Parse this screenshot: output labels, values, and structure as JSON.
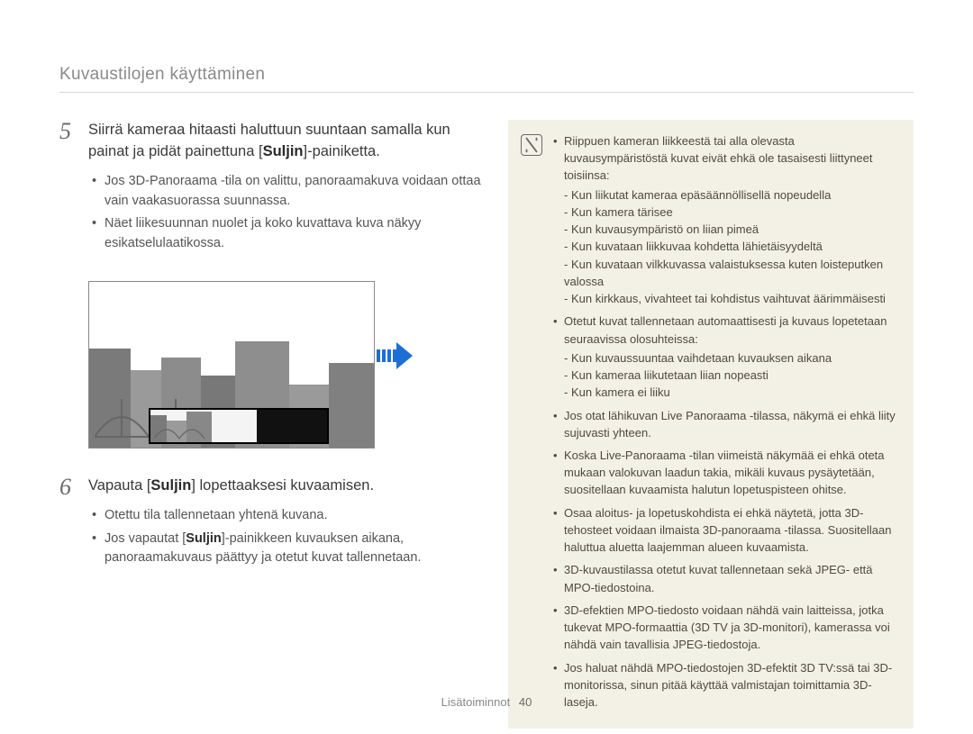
{
  "header": {
    "title": "Kuvaustilojen käyttäminen"
  },
  "steps": {
    "s5": {
      "num": "5",
      "title_before": "Siirrä kameraa hitaasti haluttuun suuntaan samalla kun painat ja pidät painettuna [",
      "title_bold": "Suljin",
      "title_after": "]-painiketta.",
      "bullets": [
        "Jos 3D-Panoraama -tila on valittu, panoraamakuva voidaan ottaa vain vaakasuorassa suunnassa.",
        "Näet liikesuunnan nuolet ja koko kuvattava kuva näkyy esikatselulaatikossa."
      ]
    },
    "s6": {
      "num": "6",
      "title_before": "Vapauta [",
      "title_bold": "Suljin",
      "title_after": "] lopettaaksesi kuvaamisen.",
      "bullets_plain": "Otettu tila tallennetaan yhtenä kuvana.",
      "bullet2_before": "Jos vapautat [",
      "bullet2_bold": "Suljin",
      "bullet2_after": "]-painikkeen kuvauksen aikana, panoraamakuvaus päättyy ja otetut kuvat tallennetaan."
    }
  },
  "info": {
    "b1": {
      "text": "Riippuen kameran liikkeestä tai alla olevasta kuvausympäristöstä kuvat eivät ehkä ole tasaisesti liittyneet toisiinsa:",
      "subs": [
        "Kun liikutat kameraa epäsäännöllisellä nopeudella",
        "Kun kamera tärisee",
        "Kun kuvausympäristö on liian pimeä",
        "Kun kuvataan liikkuvaa kohdetta lähietäisyydeltä",
        "Kun kuvataan vilkkuvassa valaistuksessa kuten loisteputken valossa",
        "Kun kirkkaus, vivahteet tai kohdistus vaihtuvat äärimmäisesti"
      ]
    },
    "b2": {
      "text": "Otetut kuvat tallennetaan automaattisesti ja kuvaus lopetetaan seuraavissa olosuhteissa:",
      "subs": [
        "Kun kuvaussuuntaa vaihdetaan kuvauksen aikana",
        "Kun kameraa liikutetaan liian nopeasti",
        "Kun kamera ei liiku"
      ]
    },
    "b3": "Jos otat lähikuvan Live Panoraama -tilassa, näkymä ei ehkä liity sujuvasti yhteen.",
    "b4": "Koska Live-Panoraama -tilan viimeistä näkymää ei ehkä oteta mukaan valokuvan laadun takia, mikäli kuvaus pysäytetään, suositellaan kuvaamista halutun lopetuspisteen ohitse.",
    "b5": "Osaa aloitus- ja lopetuskohdista ei ehkä näytetä, jotta 3D-tehosteet voidaan ilmaista 3D-panoraama -tilassa. Suositellaan haluttua aluetta laajemman alueen kuvaamista.",
    "b6": "3D-kuvaustilassa otetut kuvat tallennetaan sekä JPEG- että MPO-tiedostoina.",
    "b7": "3D-efektien MPO-tiedosto voidaan nähdä vain laitteissa, jotka tukevat MPO-formaattia (3D TV ja 3D-monitori), kamerassa voi nähdä vain tavallisia JPEG-tiedostoja.",
    "b8": "Jos haluat nähdä MPO-tiedostojen 3D-efektit 3D TV:ssä tai 3D-monitorissa, sinun pitää käyttää valmistajan toimittamia 3D-laseja."
  },
  "footer": {
    "section": "Lisätoiminnot",
    "page": "40"
  }
}
